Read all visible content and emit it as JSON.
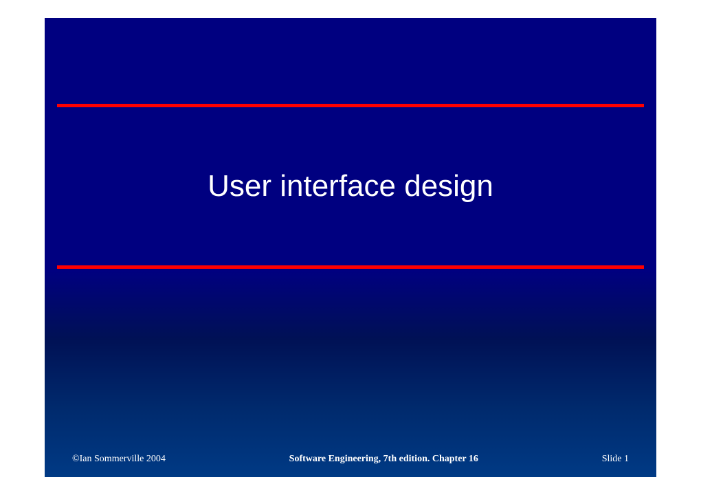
{
  "slide": {
    "title": "User interface design"
  },
  "footer": {
    "copyright": "©Ian Sommerville 2004",
    "source": "Software Engineering, 7th edition. Chapter 16",
    "slide_label": "Slide  1"
  }
}
